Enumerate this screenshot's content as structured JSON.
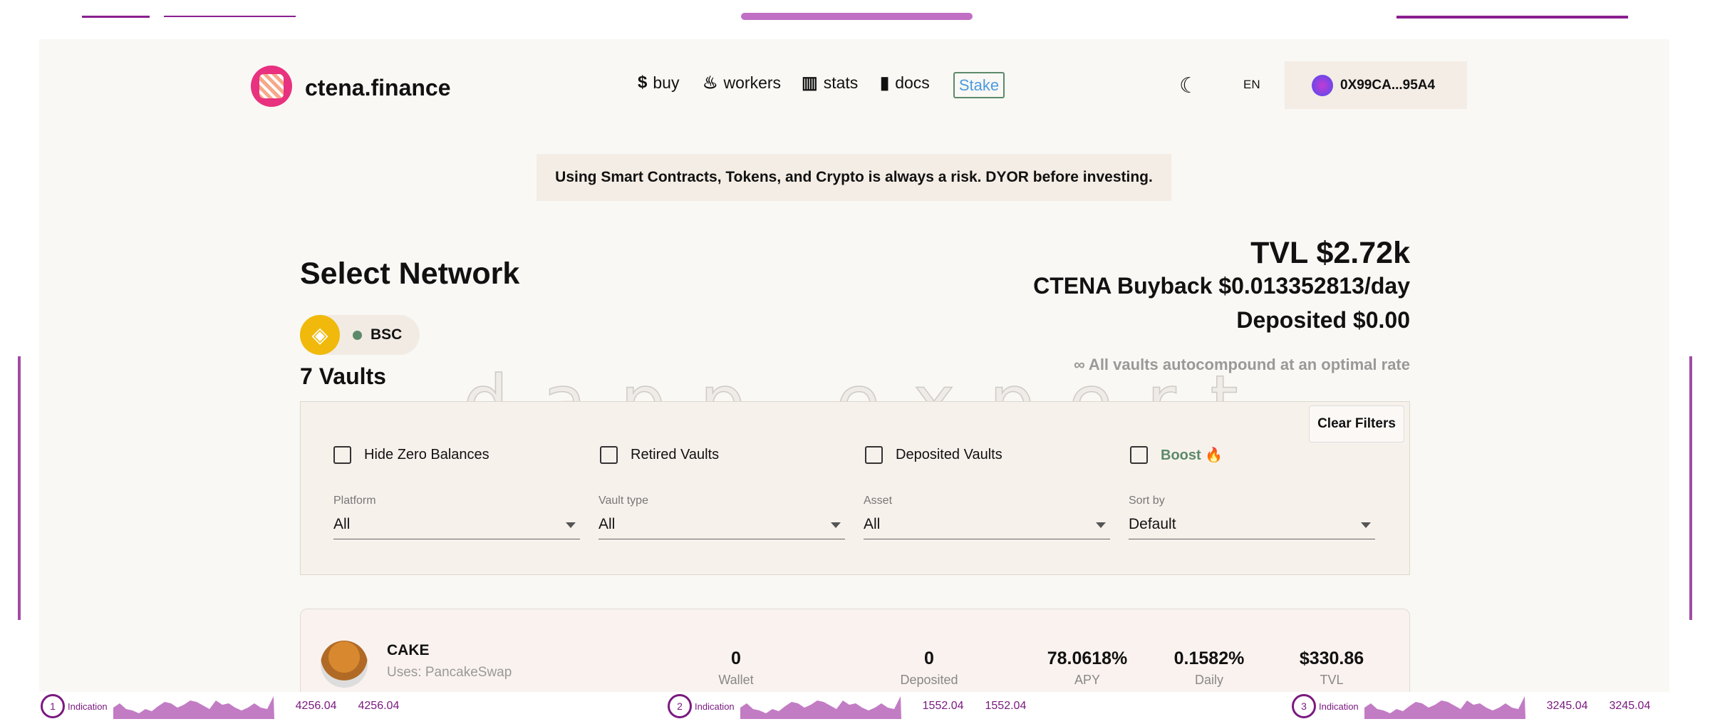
{
  "header": {
    "brand": "ctena.finance",
    "nav": [
      {
        "icon": "dollar-icon",
        "glyph": "$",
        "label": "buy"
      },
      {
        "icon": "hand-coin-icon",
        "glyph": "♨",
        "label": "workers"
      },
      {
        "icon": "bar-chart-icon",
        "glyph": "▥",
        "label": "stats"
      },
      {
        "icon": "book-icon",
        "glyph": "▮",
        "label": "docs"
      }
    ],
    "stake": "Stake",
    "theme_glyph": "☾",
    "lang": "EN",
    "wallet": "0X99CA...95A4"
  },
  "banner": "Using Smart Contracts, Tokens, and Crypto is always a risk. DYOR before investing.",
  "network": {
    "title": "Select Network",
    "selected": "BSC",
    "vault_count": "7 Vaults"
  },
  "summary": {
    "tvl": "TVL $2.72k",
    "buyback": "CTENA Buyback $0.013352813/day",
    "deposited": "Deposited $0.00",
    "autocompound": "∞ All vaults autocompound at an optimal rate"
  },
  "filters": {
    "clear": "Clear Filters",
    "checkboxes": [
      "Hide Zero Balances",
      "Retired Vaults",
      "Deposited Vaults",
      "Boost 🔥"
    ],
    "selects": [
      {
        "label": "Platform",
        "value": "All"
      },
      {
        "label": "Vault type",
        "value": "All"
      },
      {
        "label": "Asset",
        "value": "All"
      },
      {
        "label": "Sort by",
        "value": "Default"
      }
    ],
    "boost_color": "#5b8a6a"
  },
  "vault": {
    "name": "CAKE",
    "uses": "Uses: PancakeSwap",
    "stats": [
      {
        "value": "0",
        "label": "Wallet"
      },
      {
        "value": "0",
        "label": "Deposited"
      },
      {
        "value": "78.0618%",
        "label": "APY"
      },
      {
        "value": "0.1582%",
        "label": "Daily"
      },
      {
        "value": "$330.86",
        "label": "TVL"
      }
    ]
  },
  "watermark": "dapp.expert",
  "bottom": [
    {
      "n": "1",
      "label": "Indication",
      "a": "4256.04",
      "b": "4256.04"
    },
    {
      "n": "2",
      "label": "Indication",
      "a": "1552.04",
      "b": "1552.04"
    },
    {
      "n": "3",
      "label": "Indication",
      "a": "3245.04",
      "b": "3245.04"
    }
  ]
}
